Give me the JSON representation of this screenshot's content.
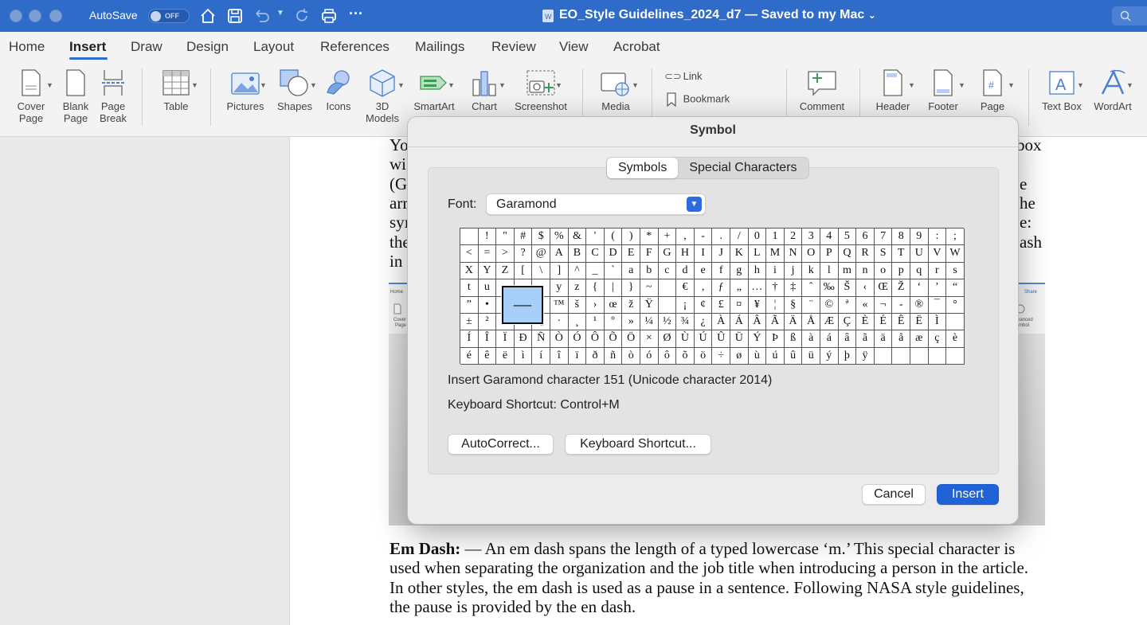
{
  "titlebar": {
    "autosave_label": "AutoSave",
    "autosave_state": "OFF",
    "doc_title": "EO_Style Guidelines_2024_d7 — Saved to my Mac",
    "title_chevron": "⌄"
  },
  "menu": {
    "tabs": [
      "Home",
      "Insert",
      "Draw",
      "Design",
      "Layout",
      "References",
      "Mailings",
      "Review",
      "View",
      "Acrobat"
    ],
    "active": "Insert"
  },
  "ribbon": {
    "cover_page": [
      "Cover",
      "Page"
    ],
    "blank_page": [
      "Blank",
      "Page"
    ],
    "page_break": [
      "Page",
      "Break"
    ],
    "table": "Table",
    "pictures": "Pictures",
    "shapes": "Shapes",
    "icons": "Icons",
    "models": [
      "3D",
      "Models"
    ],
    "smartart": "SmartArt",
    "chart": "Chart",
    "screenshot": "Screenshot",
    "media": "Media",
    "link": "Link",
    "bookmark": "Bookmark",
    "comment": "Comment",
    "header": "Header",
    "footer": "Footer",
    "page": "Page",
    "text_box": "Text Box",
    "wordart": "WordArt"
  },
  "document": {
    "partial_left": [
      "Yo",
      "wi",
      "(G",
      "arr",
      "syı",
      "the",
      "in I"
    ],
    "partial_right": [
      "box",
      "e",
      "he",
      "e:",
      "ash"
    ],
    "em_dash_label": "Em Dash:",
    "lines": [
      "— An em dash spans the length of a typed lowercase ‘m.’ This special character is",
      "used when separating the organization and the job title when introducing a person in the article.",
      "In other styles, the em dash is used as a pause in a sentence. Following NASA style guidelines,",
      "the pause is provided by the en dash."
    ],
    "embedded_labels": {
      "home": "Home",
      "cover": "Cover",
      "page": "Page",
      "share": "Share",
      "advanced": "Advanced",
      "symbol": "Symbol"
    }
  },
  "dialog": {
    "title": "Symbol",
    "tabs": [
      "Symbols",
      "Special Characters"
    ],
    "font_label": "Font:",
    "font_value": "Garamond",
    "grid_rows": [
      [
        " ",
        "!",
        "\"",
        "#",
        "$",
        "%",
        "&",
        "'",
        "(",
        ")",
        "*",
        "+",
        ",",
        "-",
        ".",
        "/",
        "0",
        "1",
        "2",
        "3",
        "4",
        "5",
        "6",
        "7",
        "8",
        "9",
        ":",
        ";"
      ],
      [
        "<",
        "=",
        ">",
        "?",
        "@",
        "A",
        "B",
        "C",
        "D",
        "E",
        "F",
        "G",
        "H",
        "I",
        "J",
        "K",
        "L",
        "M",
        "N",
        "O",
        "P",
        "Q",
        "R",
        "S",
        "T",
        "U",
        "V",
        "W"
      ],
      [
        "X",
        "Y",
        "Z",
        "[",
        "\\",
        "]",
        "^",
        "_",
        "`",
        "a",
        "b",
        "c",
        "d",
        "e",
        "f",
        "g",
        "h",
        "i",
        "j",
        "k",
        "l",
        "m",
        "n",
        "o",
        "p",
        "q",
        "r",
        "s"
      ],
      [
        "t",
        "u",
        "",
        "",
        "",
        "y",
        "z",
        "{",
        "|",
        "}",
        "~",
        "",
        "€",
        ",",
        "ƒ",
        "„",
        "…",
        "†",
        "‡",
        "ˆ",
        "‰",
        "Š",
        "‹",
        "Œ",
        "Ž",
        "‘",
        "’",
        "“"
      ],
      [
        "”",
        "•",
        "",
        "",
        "",
        "™",
        "š",
        "›",
        "œ",
        "ž",
        "Ÿ",
        "",
        "¡",
        "¢",
        "£",
        "¤",
        "¥",
        "¦",
        "§",
        "¨",
        "©",
        "ª",
        "«",
        "¬",
        "-",
        "®",
        "¯",
        "°"
      ],
      [
        "±",
        "²",
        "",
        "",
        "¶",
        "·",
        "¸",
        "¹",
        "º",
        "»",
        "¼",
        "½",
        "¾",
        "¿",
        "À",
        "Á",
        "Â",
        "Ã",
        "Ä",
        "Å",
        "Æ",
        "Ç",
        "È",
        "É",
        "Ê",
        "Ë",
        "Ì",
        ""
      ],
      [
        "Í",
        "Î",
        "Ï",
        "Ð",
        "Ñ",
        "Ò",
        "Ó",
        "Ô",
        "Õ",
        "Ö",
        "×",
        "Ø",
        "Ù",
        "Ú",
        "Û",
        "Ü",
        "Ý",
        "Þ",
        "ß",
        "à",
        "á",
        "â",
        "ã",
        "ä",
        "å",
        "æ",
        "ç",
        "è"
      ],
      [
        "é",
        "ê",
        "ë",
        "ì",
        "í",
        "î",
        "ï",
        "ð",
        "ñ",
        "ò",
        "ó",
        "ô",
        "õ",
        "ö",
        "÷",
        "ø",
        "ù",
        "ú",
        "û",
        "ü",
        "ý",
        "þ",
        "ÿ",
        "",
        "",
        "",
        "",
        ""
      ]
    ],
    "selected_char": "—",
    "char_info": "Insert Garamond character 151  (Unicode character 2014)",
    "shortcut_info": "Keyboard Shortcut:  Control+M",
    "autocorrect_button": "AutoCorrect...",
    "keyboard_shortcut_button": "Keyboard Shortcut...",
    "cancel_button": "Cancel",
    "insert_button": "Insert"
  },
  "colors": {
    "titlebar": "#2f6cc9",
    "accent": "#1f63d6",
    "selected_cell": "#a8cff8"
  }
}
